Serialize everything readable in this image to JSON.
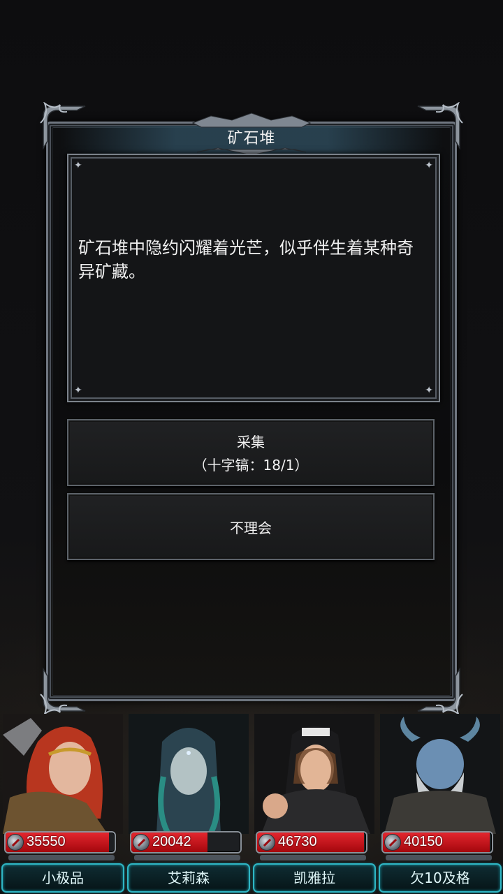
{
  "dialog": {
    "title": "矿石堆",
    "body": "矿石堆中隐约闪耀着光芒，似乎伴生着某种奇异矿藏。",
    "options": [
      {
        "label": "采集",
        "sub": "（十字镐：18/1）"
      },
      {
        "label": "不理会",
        "sub": ""
      }
    ]
  },
  "party": [
    {
      "name": "小极品",
      "hp": "35550",
      "hp_fill_fraction": 0.95,
      "portrait": "red-haired-warrior-portrait"
    },
    {
      "name": "艾莉森",
      "hp": "20042",
      "hp_fill_fraction": 0.7,
      "portrait": "hooded-sorceress-portrait"
    },
    {
      "name": "凯雅拉",
      "hp": "46730",
      "hp_fill_fraction": 0.98,
      "portrait": "nun-fighter-portrait"
    },
    {
      "name": "欠10及格",
      "hp": "40150",
      "hp_fill_fraction": 0.98,
      "portrait": "horned-dwarf-portrait"
    }
  ],
  "colors": {
    "hp_red": "#d8141c",
    "nameplate_cyan": "#2fb6c4",
    "frame_steel": "#6f7680"
  }
}
